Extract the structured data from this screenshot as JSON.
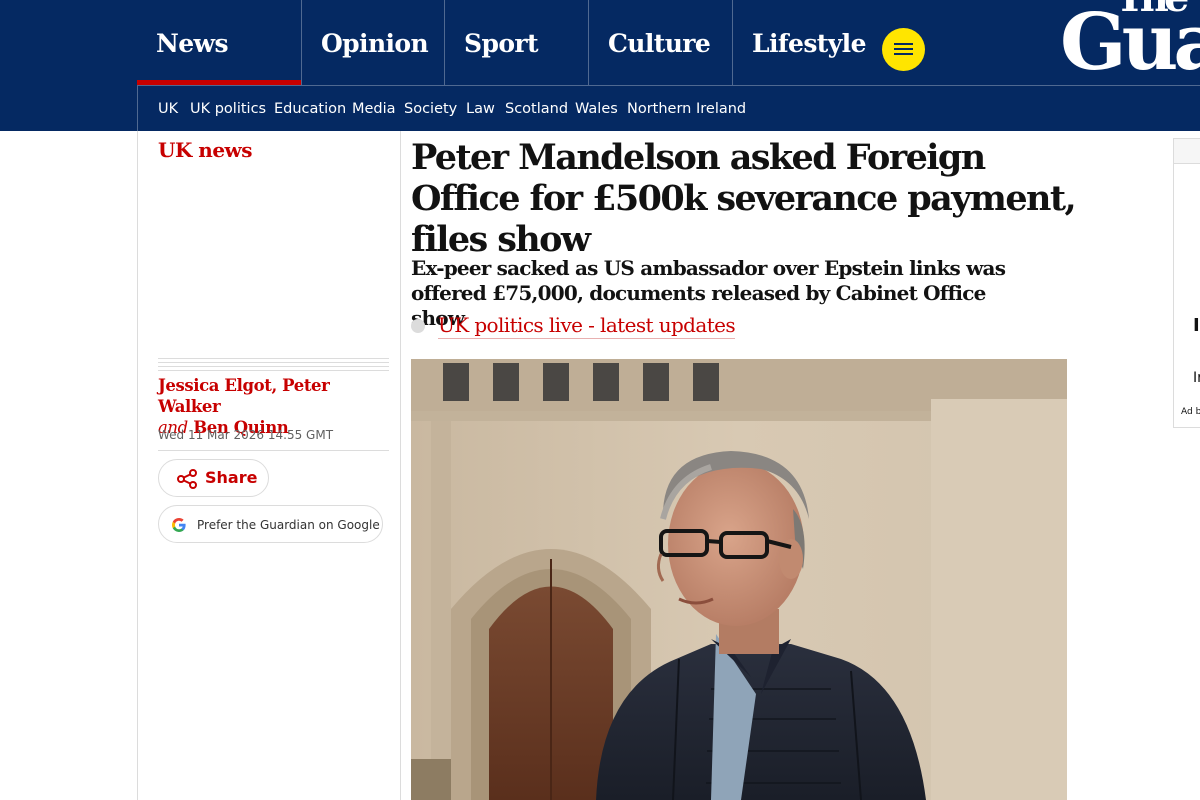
{
  "header": {
    "pillars": [
      {
        "label": "News",
        "active": true
      },
      {
        "label": "Opinion",
        "active": false
      },
      {
        "label": "Sport",
        "active": false
      },
      {
        "label": "Culture",
        "active": false
      },
      {
        "label": "Lifestyle",
        "active": false
      }
    ],
    "brand_top": "The",
    "brand_main": "Guardian",
    "subnav": [
      "UK",
      "UK politics",
      "Education",
      "Media",
      "Society",
      "Law",
      "Scotland",
      "Wales",
      "Northern Ireland"
    ]
  },
  "colors": {
    "masthead": "#052962",
    "news_red": "#c70000",
    "menu_yellow": "#ffe500",
    "rule_grey": "#dcdcdc"
  },
  "icons": {
    "menu": "hamburger-icon",
    "share": "share-icon",
    "google": "google-g-icon",
    "bullet": "grey-dot-icon"
  },
  "article": {
    "section": "UK news",
    "headline": "Peter Mandelson asked Foreign Office for £500k severance payment, files show",
    "standfirst": "Ex-peer sacked as US ambassador over Epstein links was offered £75,000, documents released by Cabinet Office show",
    "live_link": "UK politics live - latest updates",
    "authors": [
      "Jessica Elgot",
      "Peter Walker",
      "Ben Quinn"
    ],
    "author_sep": ",",
    "author_and": "and",
    "date": "Wed 11 Mar 2026 14.55 GMT",
    "share_label": "Share",
    "google_label": "Prefer the Guardian on Google"
  },
  "ad": {
    "letter1": "I",
    "letter2": "Ir",
    "tag": "Ad b"
  }
}
